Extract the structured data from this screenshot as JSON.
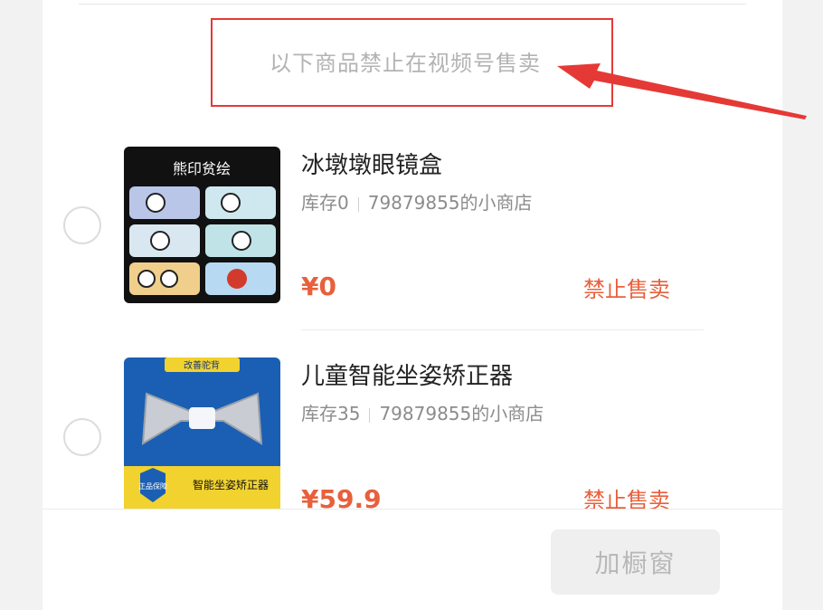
{
  "notice": {
    "text": "以下商品禁止在视频号售卖"
  },
  "products": [
    {
      "title": "冰墩墩眼镜盒",
      "stock": "库存0",
      "shop": "79879855的小商店",
      "price": "¥0",
      "status": "禁止售卖",
      "image_caption": "熊印贫绘"
    },
    {
      "title": "儿童智能坐姿矫正器",
      "stock": "库存35",
      "shop": "79879855的小商店",
      "price": "¥59.9",
      "status": "禁止售卖",
      "image_top_tag": "改善驼背",
      "image_caption": "智能坐姿矫正器",
      "image_badge": "正品保障"
    }
  ],
  "footer": {
    "add_button": "加橱窗"
  },
  "colors": {
    "accent": "#e8603c",
    "annotation": "#e53935"
  }
}
